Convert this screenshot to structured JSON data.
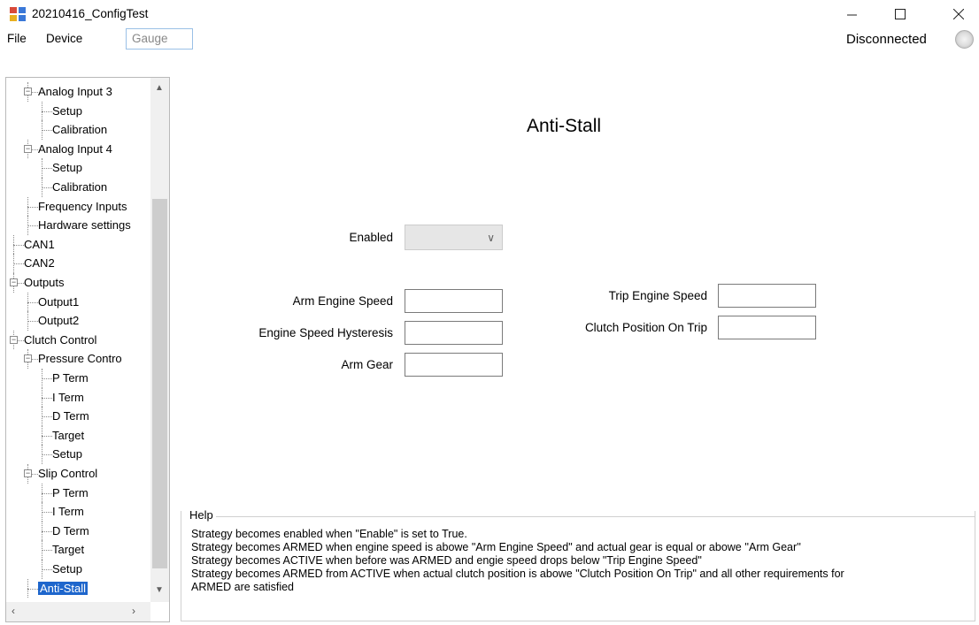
{
  "window": {
    "title": "20210416_ConfigTest"
  },
  "menubar": {
    "items": [
      "File",
      "Device",
      "Gauge"
    ],
    "status": "Disconnected"
  },
  "tree": {
    "items": [
      {
        "label": "Analog Input 3",
        "depth": 1,
        "expanded": true
      },
      {
        "label": "Setup",
        "depth": 2
      },
      {
        "label": "Calibration",
        "depth": 2
      },
      {
        "label": "Analog Input 4",
        "depth": 1,
        "expanded": true
      },
      {
        "label": "Setup",
        "depth": 2
      },
      {
        "label": "Calibration",
        "depth": 2
      },
      {
        "label": "Frequency Inputs",
        "depth": 1
      },
      {
        "label": "Hardware settings",
        "depth": 1
      },
      {
        "label": "CAN1",
        "depth": 0
      },
      {
        "label": "CAN2",
        "depth": 0
      },
      {
        "label": "Outputs",
        "depth": 0,
        "expanded": true
      },
      {
        "label": "Output1",
        "depth": 1
      },
      {
        "label": "Output2",
        "depth": 1
      },
      {
        "label": "Clutch Control",
        "depth": 0,
        "expanded": true
      },
      {
        "label": "Pressure Contro",
        "depth": 1,
        "expanded": true
      },
      {
        "label": "P Term",
        "depth": 2
      },
      {
        "label": "I Term",
        "depth": 2
      },
      {
        "label": "D Term",
        "depth": 2
      },
      {
        "label": "Target",
        "depth": 2
      },
      {
        "label": "Setup",
        "depth": 2
      },
      {
        "label": "Slip Control",
        "depth": 1,
        "expanded": true
      },
      {
        "label": "P Term",
        "depth": 2
      },
      {
        "label": "I Term",
        "depth": 2
      },
      {
        "label": "D Term",
        "depth": 2
      },
      {
        "label": "Target",
        "depth": 2
      },
      {
        "label": "Setup",
        "depth": 2
      },
      {
        "label": "Anti-Stall",
        "depth": 1,
        "selected": true
      }
    ]
  },
  "page": {
    "title": "Anti-Stall"
  },
  "form": {
    "enabled_label": "Enabled",
    "enabled_value": "",
    "arm_engine_speed_label": "Arm Engine Speed",
    "arm_engine_speed_value": "",
    "engine_speed_hysteresis_label": "Engine Speed Hysteresis",
    "engine_speed_hysteresis_value": "",
    "arm_gear_label": "Arm Gear",
    "arm_gear_value": "",
    "trip_engine_speed_label": "Trip Engine Speed",
    "trip_engine_speed_value": "",
    "clutch_position_on_trip_label": "Clutch Position On Trip",
    "clutch_position_on_trip_value": ""
  },
  "help": {
    "legend": "Help",
    "lines": [
      "Strategy becomes enabled when \"Enable\" is set to True.",
      "Strategy becomes ARMED when engine speed is abowe \"Arm Engine Speed\" and actual gear is equal or abowe ''Arm Gear''",
      "Strategy becomes ACTIVE when before was ARMED and engie speed drops below \"Trip Engine Speed\"",
      "Strategy becomes ARMED from ACTIVE when actual clutch position is abowe \"Clutch Position On Trip\" and all other requirements for",
      "ARMED are satisfied"
    ]
  },
  "colors": {
    "selection": "#1e66cc",
    "menu_highlight_border": "#9ac0e6"
  }
}
